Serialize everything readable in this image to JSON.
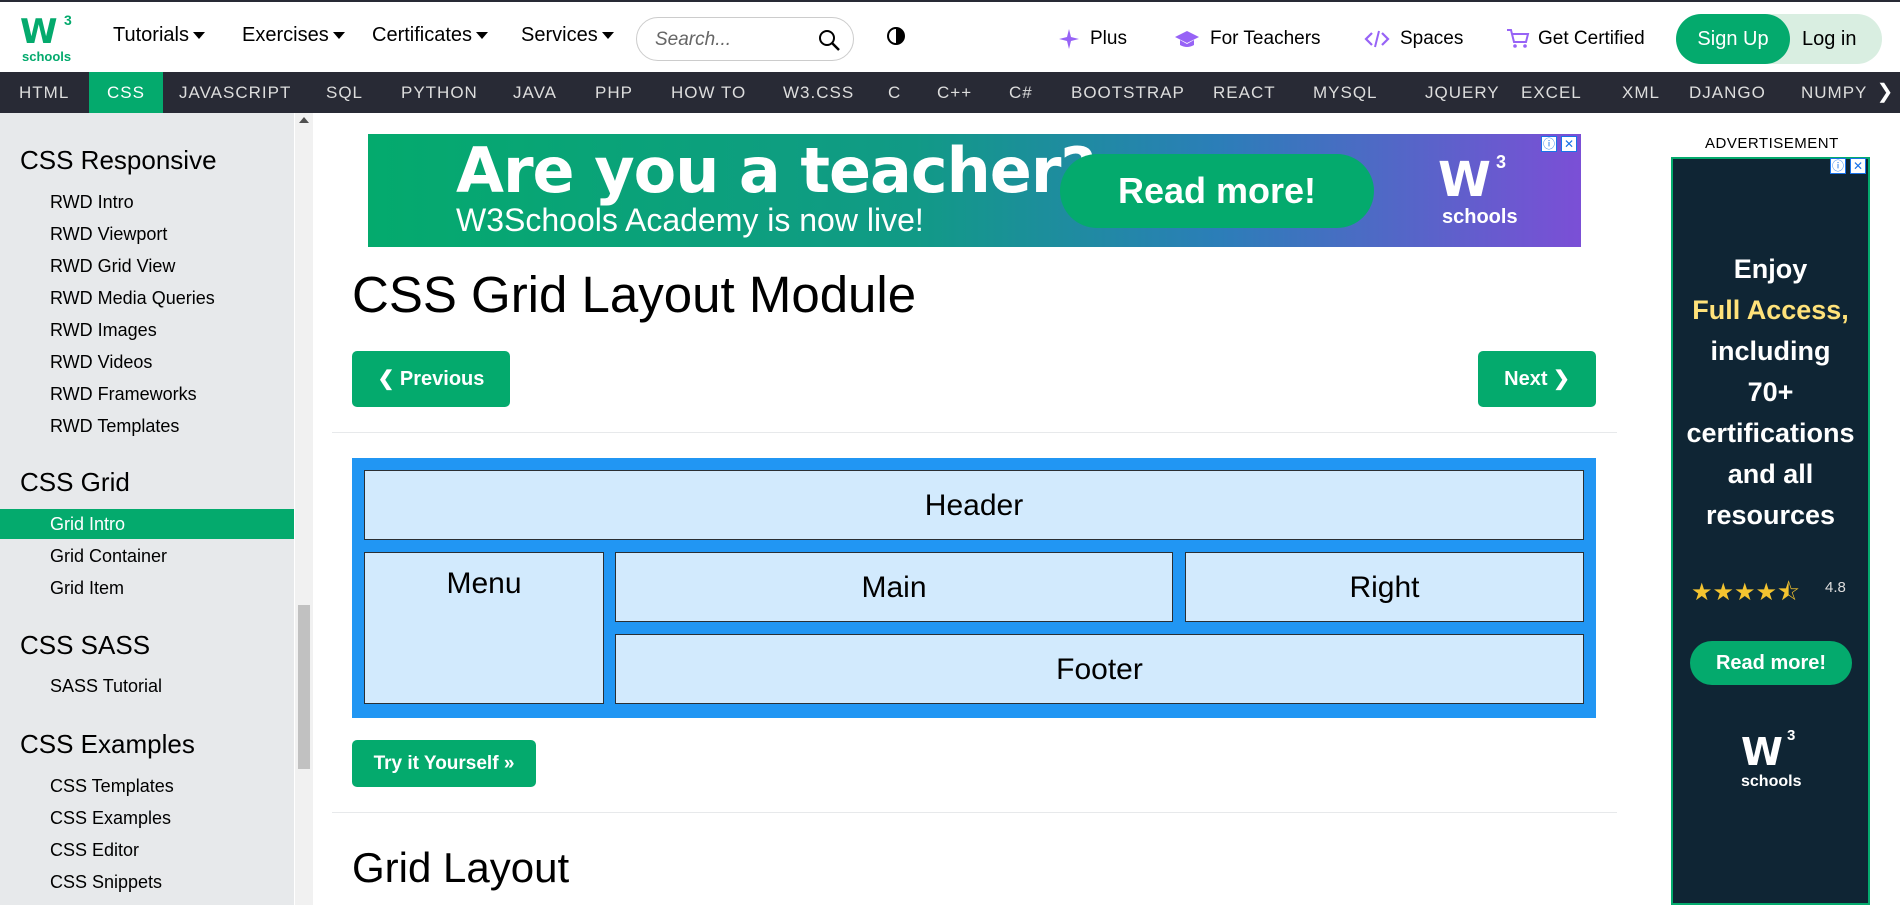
{
  "logo": {
    "main": "W",
    "sup": "3",
    "sub": "schools"
  },
  "topnav": {
    "tutorials": "Tutorials",
    "exercises": "Exercises",
    "certificates": "Certificates",
    "services": "Services",
    "search_placeholder": "Search...",
    "plus": "Plus",
    "for_teachers": "For Teachers",
    "spaces": "Spaces",
    "get_certified": "Get Certified",
    "signup": "Sign Up",
    "login": "Log in"
  },
  "darknav": {
    "items": [
      "HTML",
      "CSS",
      "JAVASCRIPT",
      "SQL",
      "PYTHON",
      "JAVA",
      "PHP",
      "HOW TO",
      "W3.CSS",
      "C",
      "C++",
      "C#",
      "BOOTSTRAP",
      "REACT",
      "MYSQL",
      "JQUERY",
      "EXCEL",
      "XML",
      "DJANGO",
      "NUMPY"
    ],
    "active": "CSS",
    "arrow": "❯"
  },
  "sidebar": {
    "sections": [
      {
        "heading": "CSS Responsive",
        "items": [
          "RWD Intro",
          "RWD Viewport",
          "RWD Grid View",
          "RWD Media Queries",
          "RWD Images",
          "RWD Videos",
          "RWD Frameworks",
          "RWD Templates"
        ]
      },
      {
        "heading": "CSS Grid",
        "items": [
          "Grid Intro",
          "Grid Container",
          "Grid Item"
        ]
      },
      {
        "heading": "CSS SASS",
        "items": [
          "SASS Tutorial"
        ]
      },
      {
        "heading": "CSS Examples",
        "items": [
          "CSS Templates",
          "CSS Examples",
          "CSS Editor",
          "CSS Snippets"
        ]
      }
    ],
    "active_item": "Grid Intro"
  },
  "banner_ad": {
    "title": "Are you a teacher?",
    "subtitle": "W3Schools Academy is now live!",
    "button": "Read more!",
    "logo_main": "W",
    "logo_sup": "3",
    "logo_sub": "schools"
  },
  "main": {
    "title": "CSS Grid Layout Module",
    "prev_button": "❮ Previous",
    "next_button": "Next ❯",
    "grid_demo": {
      "header": "Header",
      "menu": "Menu",
      "main": "Main",
      "right": "Right",
      "footer": "Footer"
    },
    "try_button": "Try it Yourself »",
    "section_heading": "Grid Layout"
  },
  "right_ad": {
    "label": "ADVERTISEMENT",
    "line1": "Enjoy",
    "line2": "Full Access,",
    "line3": "including",
    "line4": "70+",
    "line5": "certifications",
    "line6": "and all",
    "line7": "resources",
    "stars": "★★★★⯪",
    "rating": "4.8",
    "button": "Read more!",
    "logo_main": "W",
    "logo_sup": "3",
    "logo_sub": "schools"
  },
  "colors": {
    "accent": "#04aa6d",
    "dark_nav": "#282a35",
    "sidebar_bg": "#e7e9eb",
    "grid_blue": "#2196f3"
  }
}
